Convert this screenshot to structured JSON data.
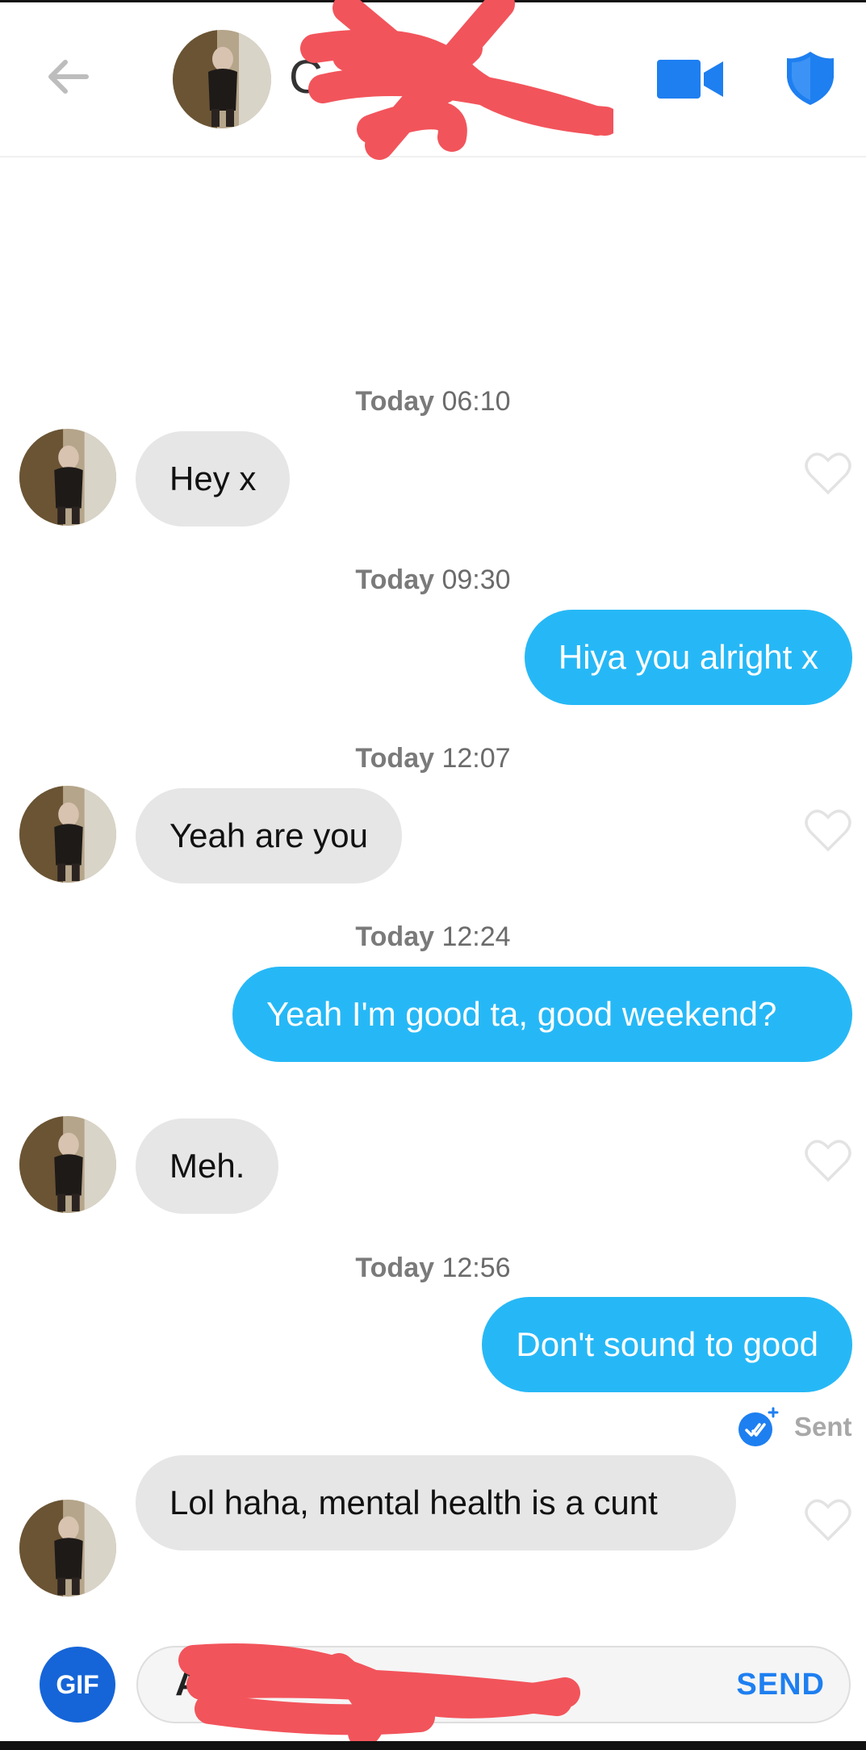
{
  "header": {
    "name_visible": "C",
    "back_icon": "arrow-left-icon",
    "video_icon": "video-camera-icon",
    "safety_icon": "shield-icon"
  },
  "colors": {
    "outgoing_bubble": "#26b8f6",
    "incoming_bubble": "#e6e6e6",
    "accent_blue": "#1e7ff0",
    "redaction": "#f2545b"
  },
  "messages": [
    {
      "timestamp_day": "Today",
      "timestamp_time": "06:10",
      "text": "Hey x"
    },
    {
      "timestamp_day": "Today",
      "timestamp_time": "09:30",
      "text": "Hiya you alright x"
    },
    {
      "timestamp_day": "Today",
      "timestamp_time": "12:07",
      "text": "Yeah are you"
    },
    {
      "timestamp_day": "Today",
      "timestamp_time": "12:24",
      "text": "Yeah I'm good ta, good weekend?"
    },
    {
      "text": "Meh."
    },
    {
      "timestamp_day": "Today",
      "timestamp_time": "12:56",
      "text": "Don't sound to good"
    },
    {
      "text": "Lol haha, mental health is a cunt"
    }
  ],
  "status": {
    "sent_label": "Sent"
  },
  "composer": {
    "gif_label": "GIF",
    "input_visible_text": "A",
    "send_label": "SEND"
  }
}
